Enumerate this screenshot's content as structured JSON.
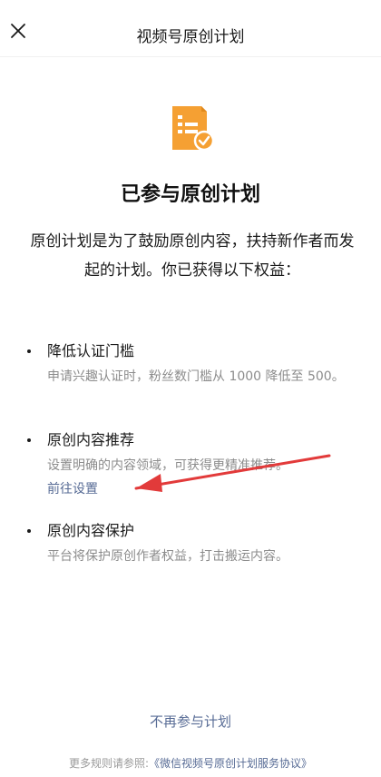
{
  "header": {
    "title": "视频号原创计划"
  },
  "main": {
    "heading": "已参与原创计划",
    "intro": "原创计划是为了鼓励原创内容，扶持新作者而发起的计划。你已获得以下权益："
  },
  "benefits": [
    {
      "title": "降低认证门槛",
      "description": "申请兴趣认证时，粉丝数门槛从 1000 降低至 500。"
    },
    {
      "title": "原创内容推荐",
      "description": "设置明确的内容领域，可获得更精准推荐。",
      "link": "前往设置"
    },
    {
      "title": "原创内容保护",
      "description": "平台将保护原创作者权益，打击搬运内容。"
    }
  ],
  "actions": {
    "quit_label": "不再参与计划"
  },
  "footer": {
    "prefix": "更多规则请参照:",
    "agreement_link": "《微信视频号原创计划服务协议》"
  },
  "colors": {
    "accent_orange": "#f5a033",
    "link_blue": "#576b95",
    "arrow_red": "#e23a3a"
  }
}
